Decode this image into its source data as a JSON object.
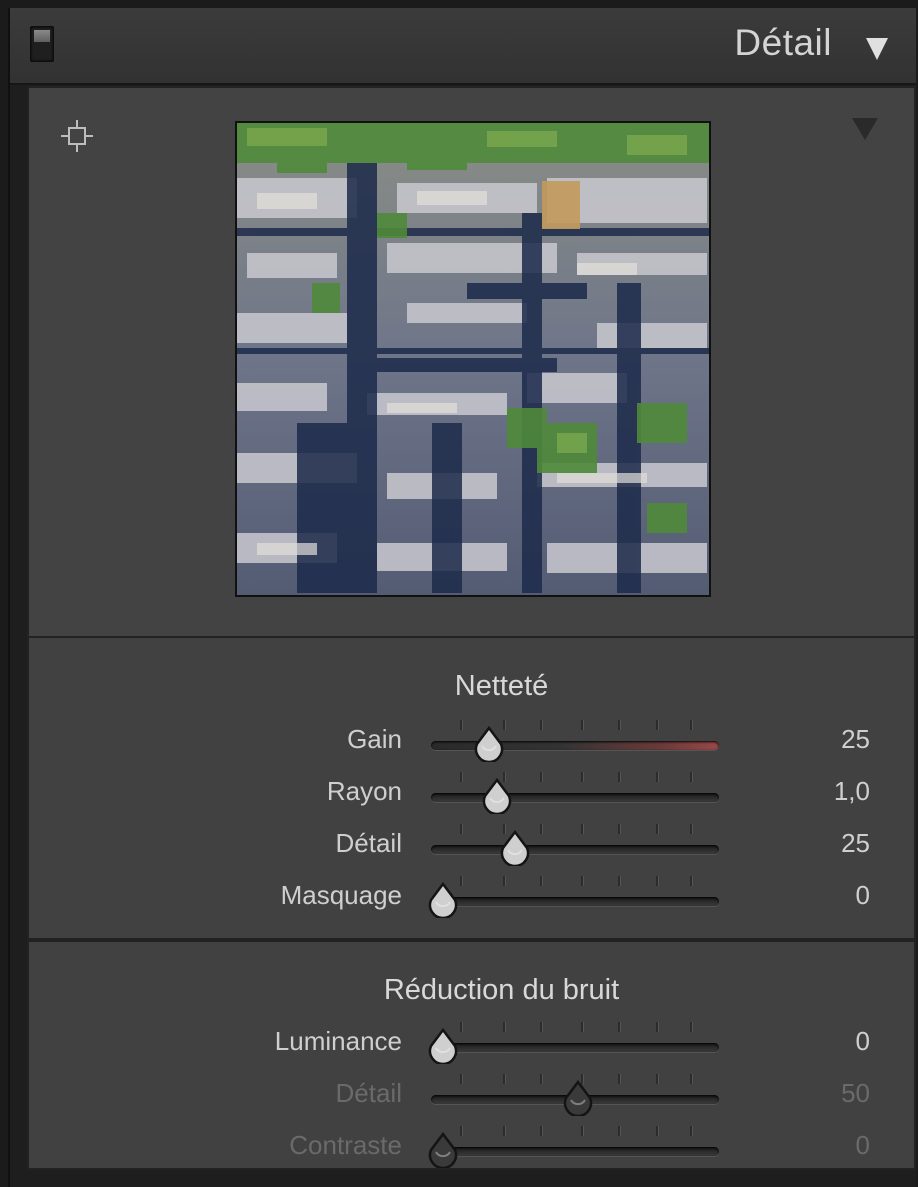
{
  "panel": {
    "title": "Détail"
  },
  "sharpening": {
    "title": "Netteté",
    "sliders": [
      {
        "label": "Gain",
        "value": "25",
        "fraction": 0.2,
        "red_track": true,
        "dim": false
      },
      {
        "label": "Rayon",
        "value": "1,0",
        "fraction": 0.23,
        "red_track": false,
        "dim": false
      },
      {
        "label": "Détail",
        "value": "25",
        "fraction": 0.29,
        "red_track": false,
        "dim": false
      },
      {
        "label": "Masquage",
        "value": "0",
        "fraction": 0.04,
        "red_track": false,
        "dim": false
      }
    ]
  },
  "noise_reduction": {
    "title": "Réduction du bruit",
    "sliders": [
      {
        "label": "Luminance",
        "value": "0",
        "fraction": 0.04,
        "red_track": false,
        "dim": false
      },
      {
        "label": "Détail",
        "value": "50",
        "fraction": 0.51,
        "red_track": false,
        "dim": true
      },
      {
        "label": "Contraste",
        "value": "0",
        "fraction": 0.04,
        "red_track": false,
        "dim": true
      }
    ]
  },
  "colors": {
    "thumb": "#cfcfcf",
    "thumb_dim": "#3a3a3a",
    "text": "#cfcfcf",
    "text_dim": "#6a6a6a"
  },
  "icons": {
    "target": "target-adjust-icon",
    "preview_menu": "triangle-down-icon",
    "panel_collapse": "triangle-down-icon"
  }
}
